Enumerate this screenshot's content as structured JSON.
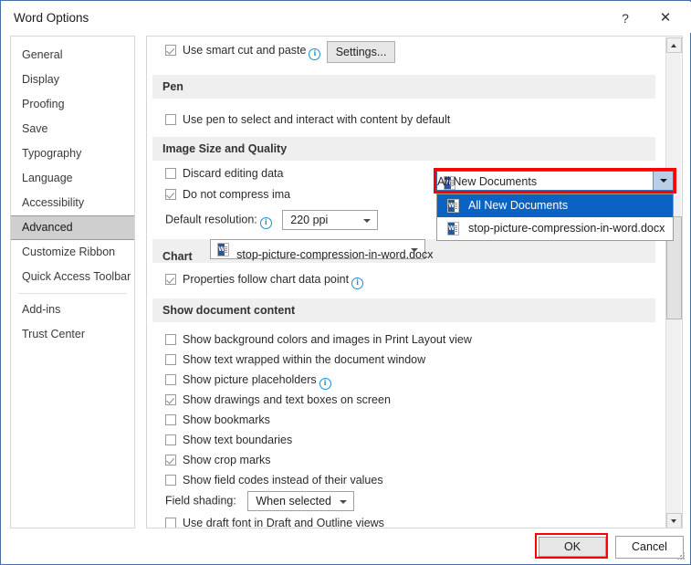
{
  "window": {
    "title": "Word Options",
    "help_icon": "?",
    "close_icon": "✕"
  },
  "sidebar": {
    "items": [
      {
        "label": "General",
        "selected": false
      },
      {
        "label": "Display",
        "selected": false
      },
      {
        "label": "Proofing",
        "selected": false
      },
      {
        "label": "Save",
        "selected": false
      },
      {
        "label": "Typography",
        "selected": false
      },
      {
        "label": "Language",
        "selected": false
      },
      {
        "label": "Accessibility",
        "selected": false
      },
      {
        "label": "Advanced",
        "selected": true
      },
      {
        "label": "Customize Ribbon",
        "selected": false
      },
      {
        "label": "Quick Access Toolbar",
        "selected": false
      },
      {
        "label": "Add-ins",
        "selected": false
      },
      {
        "label": "Trust Center",
        "selected": false
      }
    ]
  },
  "content": {
    "cut_copy_paste": {
      "smart_cut_paste_label": "Use smart cut and paste",
      "smart_cut_paste_checked": true,
      "settings_button": "Settings..."
    },
    "pen": {
      "header": "Pen",
      "use_pen_label": "Use pen to select and interact with content by default",
      "use_pen_checked": false
    },
    "image_size_quality": {
      "header": "Image Size and Quality",
      "scope_value": "All New Documents",
      "discard_editing_label": "Discard editing data",
      "discard_editing_checked": false,
      "do_not_compress_label": "Do not compress ima",
      "do_not_compress_checked": true,
      "default_resolution_label": "Default resolution:",
      "default_resolution_value": "220 ppi"
    },
    "dropdown": {
      "open": true,
      "options": [
        {
          "label": "All New Documents",
          "highlighted": true
        },
        {
          "label": "stop-picture-compression-in-word.docx",
          "highlighted": false
        }
      ]
    },
    "chart": {
      "header": "Chart",
      "scope_value": "stop-picture-compression-in-word.docx",
      "properties_follow_label": "Properties follow chart data point",
      "properties_follow_checked": true
    },
    "show_document_content": {
      "header": "Show document content",
      "checkboxes": [
        {
          "label": "Show background colors and images in Print Layout view",
          "checked": false,
          "info": false
        },
        {
          "label": "Show text wrapped within the document window",
          "checked": false,
          "info": false
        },
        {
          "label": "Show picture placeholders",
          "checked": false,
          "info": true
        },
        {
          "label": "Show drawings and text boxes on screen",
          "checked": true,
          "info": false
        },
        {
          "label": "Show bookmarks",
          "checked": false,
          "info": false
        },
        {
          "label": "Show text boundaries",
          "checked": false,
          "info": false
        },
        {
          "label": "Show crop marks",
          "checked": true,
          "info": false
        },
        {
          "label": "Show field codes instead of their values",
          "checked": false,
          "info": false
        }
      ],
      "field_shading_label": "Field shading:",
      "field_shading_value": "When selected",
      "draft_font_label": "Use draft font in Draft and Outline views",
      "draft_font_checked": false
    }
  },
  "footer": {
    "ok_label": "OK",
    "cancel_label": "Cancel"
  },
  "colors": {
    "highlight_blue": "#0a63c2",
    "annotation_red": "#ff0000",
    "window_border": "#4a6fa5",
    "section_header_bg": "#efefef",
    "word_icon_blue": "#2b579a"
  }
}
